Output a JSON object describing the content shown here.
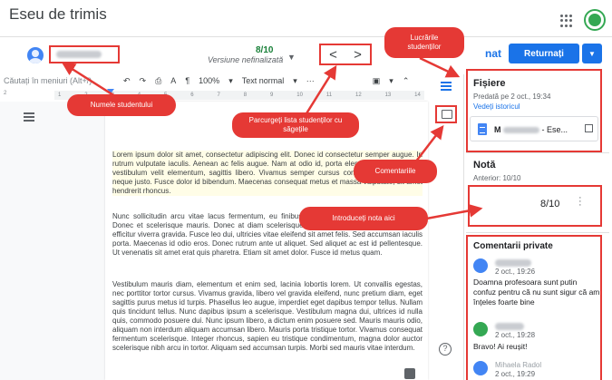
{
  "app": {
    "title": "Eseu de trimis"
  },
  "student": {
    "grade": "8/10",
    "status": "Versiune nefinalizată"
  },
  "nav": {
    "prev": "<",
    "next": ">"
  },
  "toolbar": {
    "search_placeholder": "Căutați în meniuri (Alt+/)",
    "zoom": "100%",
    "style": "Text normal",
    "more": "···"
  },
  "ruler": {
    "ticks": [
      "1",
      "2",
      "3",
      "4",
      "5",
      "6",
      "7",
      "8",
      "9",
      "10",
      "11",
      "12",
      "13",
      "14"
    ],
    "left_tick": "2"
  },
  "document": {
    "paragraphs": [
      "Lorem ipsum dolor sit amet, consectetur adipiscing elit. Donec id consectetur semper augue. In rutrum vulputate iaculis. Aenean ac felis augue. Nam at odio id, porta elementum leo. Aenean vestibulum velit elementum, sagittis libero. Vivamus semper cursus consectetur. Aenean eu neque justo. Fusce dolor id bibendum. Maecenas consequat metus et massa vulputate, sit amet hendrerit rhoncus.",
      "Nunc sollicitudin arcu vitae lacus fermentum, eu finibus justo hendrerit. Curabitur tincidunt. Donec et scelerisque mauris. Donec at diam scelerisque, scelerisque tortor neque. Vivamus efficitur viverra gravida. Fusce leo dui, ultricies vitae eleifend sit amet felis. Sed accumsan iaculis porta. Maecenas id odio eros. Donec rutrum ante ut aliquet. Sed aliquet ac est id pellentesque. Ut venenatis sit amet erat quis pharetra. Etiam sit amet dolor. Fusce id metus quam.",
      "Vestibulum mauris diam, elementum et enim sed, lacinia lobortis lorem. Ut convallis egestas, nec porttitor tortor cursus. Vivamus gravida, libero vel gravida eleifend, nunc pretium diam, eget sagittis purus metus id turpis. Phasellus leo augue, imperdiet eget dapibus tempor tellus. Nullam quis tincidunt tellus. Nunc dapibus ipsum a scelerisque. Vestibulum magna dui, ultrices id nulla quis, commodo posuere dui. Nunc ipsum libero, a dictum enim posuere sed. Mauris mauris odio, aliquam non interdum aliquam accumsan libero. Mauris porta tristique tortor. Vivamus consequat fermentum scelerisque. Integer rhoncus, sapien eu tristique condimentum, magna dolor auctor scelerisque nibh arcu in tortor. Aliquam sed accumsan turpis. Morbi sed mauris vitae interdum."
    ]
  },
  "actions": {
    "partial_label": "nat",
    "return_button": "Returnați",
    "return_dropdown": "▼"
  },
  "files": {
    "title": "Fișiere",
    "submitted": "Predată pe 2 oct., 19:34",
    "history_link": "Vedeți istoricul",
    "file_suffix": "- Ese..."
  },
  "grade_panel": {
    "title": "Notă",
    "previous": "Anterior: 10/10",
    "value": "8/10"
  },
  "private_comments": {
    "title": "Comentarii private",
    "items": [
      {
        "time": "2 oct., 19:26",
        "text": "Doamna profesoara sunt putin confuz pentru că nu sunt sigur că am înțeles foarte bine"
      },
      {
        "time": "2 oct., 19:28",
        "text": "Bravo! Ai reușit!"
      },
      {
        "name": "Mihaela Radol",
        "time": "2 oct., 19:29"
      }
    ]
  },
  "callouts": {
    "student_name": "Numele studentului",
    "browse": "Parcurgeți lista studenților cu săgețile",
    "student_work": "Lucrările studenților",
    "comments": "Comentariile",
    "enter_grade": "Introduceți nota aici"
  },
  "colors": {
    "accent_blue": "#1a73e8",
    "annotation_red": "#e53935",
    "grade_green": "#188038"
  }
}
